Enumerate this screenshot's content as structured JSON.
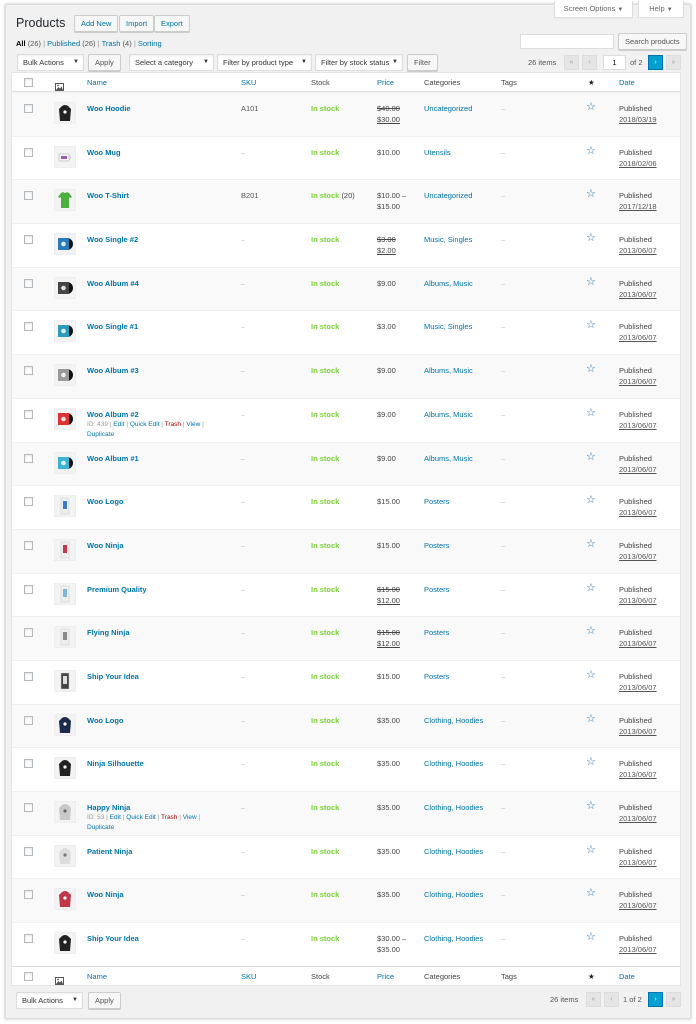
{
  "page": {
    "title": "Products",
    "add_new": "Add New",
    "import": "Import",
    "export": "Export",
    "screen_options": "Screen Options",
    "help": "Help"
  },
  "views": {
    "all": "All",
    "all_count": "(26)",
    "published": "Published",
    "published_count": "(26)",
    "trash": "Trash",
    "trash_count": "(4)",
    "sorting": "Sorting",
    "sep": "|"
  },
  "search": {
    "placeholder": "",
    "button": "Search products"
  },
  "filters": {
    "bulk_actions": "Bulk Actions",
    "apply": "Apply",
    "category": "Select a category",
    "product_type": "Filter by product type",
    "stock_status": "Filter by stock status",
    "filter": "Filter"
  },
  "pagination": {
    "items": "26 items",
    "first": "«",
    "prev": "‹",
    "next": "›",
    "last": "»",
    "current": "1",
    "of_total": "of 2",
    "bottom_label": "1 of 2"
  },
  "columns": {
    "name": "Name",
    "sku": "SKU",
    "stock": "Stock",
    "price": "Price",
    "categories": "Categories",
    "tags": "Tags",
    "featured": "★",
    "date": "Date"
  },
  "icons": {
    "image_col": "image-icon",
    "featured": "star-icon",
    "checkbox": "checkbox-icon",
    "caret": "caret-down-icon"
  },
  "colors": {
    "accent": "#0073aa",
    "in_stock": "#7ad03a",
    "trash": "#a00000",
    "pager_active": "#00a0d2"
  },
  "row_actions_labels": {
    "edit": "Edit",
    "quick_edit": "Quick Edit",
    "trash": "Trash",
    "view": "View",
    "duplicate": "Duplicate",
    "sep": "|"
  },
  "products": [
    {
      "name": "Woo Hoodie",
      "sku": "A101",
      "stock": "In stock",
      "stock_count": "",
      "price_old": "$40.00",
      "price": "$30.00",
      "categories": "Uncategorized",
      "tags": "–",
      "status": "Published",
      "date": "2018/03/19",
      "thumb": "hoodie-black",
      "id_label": ""
    },
    {
      "name": "Woo Mug",
      "sku": "–",
      "stock": "In stock",
      "stock_count": "",
      "price_old": "",
      "price": "$10.00",
      "categories": "Utensils",
      "tags": "–",
      "status": "Published",
      "date": "2018/02/06",
      "thumb": "mug",
      "id_label": ""
    },
    {
      "name": "Woo T-Shirt",
      "sku": "B201",
      "stock": "In stock",
      "stock_count": "(20)",
      "price_old": "",
      "price": "$10.00 –",
      "price2": "$15.00",
      "categories": "Uncategorized",
      "tags": "–",
      "status": "Published",
      "date": "2017/12/18",
      "thumb": "tshirt-green",
      "id_label": ""
    },
    {
      "name": "Woo Single #2",
      "sku": "–",
      "stock": "In stock",
      "stock_count": "",
      "price_old": "$3.00",
      "price": "$2.00",
      "categories": "Music, Singles",
      "tags": "–",
      "status": "Published",
      "date": "2013/06/07",
      "thumb": "album-blue",
      "id_label": ""
    },
    {
      "name": "Woo Album #4",
      "sku": "–",
      "stock": "In stock",
      "stock_count": "",
      "price_old": "",
      "price": "$9.00",
      "categories": "Albums, Music",
      "tags": "–",
      "status": "Published",
      "date": "2013/06/07",
      "thumb": "album-dark",
      "id_label": ""
    },
    {
      "name": "Woo Single #1",
      "sku": "–",
      "stock": "In stock",
      "stock_count": "",
      "price_old": "",
      "price": "$3.00",
      "categories": "Music, Singles",
      "tags": "–",
      "status": "Published",
      "date": "2013/06/07",
      "thumb": "album-teal",
      "id_label": ""
    },
    {
      "name": "Woo Album #3",
      "sku": "–",
      "stock": "In stock",
      "stock_count": "",
      "price_old": "",
      "price": "$9.00",
      "categories": "Albums, Music",
      "tags": "–",
      "status": "Published",
      "date": "2013/06/07",
      "thumb": "album-grey",
      "id_label": ""
    },
    {
      "name": "Woo Album #2",
      "sku": "–",
      "stock": "In stock",
      "stock_count": "",
      "price_old": "",
      "price": "$9.00",
      "categories": "Albums, Music",
      "tags": "–",
      "status": "Published",
      "date": "2013/06/07",
      "thumb": "album-red",
      "id_label": "ID: 439"
    },
    {
      "name": "Woo Album #1",
      "sku": "–",
      "stock": "In stock",
      "stock_count": "",
      "price_old": "",
      "price": "$9.00",
      "categories": "Albums, Music",
      "tags": "–",
      "status": "Published",
      "date": "2013/06/07",
      "thumb": "album-cyan",
      "id_label": ""
    },
    {
      "name": "Woo Logo",
      "sku": "–",
      "stock": "In stock",
      "stock_count": "",
      "price_old": "",
      "price": "$15.00",
      "categories": "Posters",
      "tags": "–",
      "status": "Published",
      "date": "2013/06/07",
      "thumb": "poster-blue",
      "id_label": ""
    },
    {
      "name": "Woo Ninja",
      "sku": "–",
      "stock": "In stock",
      "stock_count": "",
      "price_old": "",
      "price": "$15.00",
      "categories": "Posters",
      "tags": "–",
      "status": "Published",
      "date": "2013/06/07",
      "thumb": "poster-red",
      "id_label": ""
    },
    {
      "name": "Premium Quality",
      "sku": "–",
      "stock": "In stock",
      "stock_count": "",
      "price_old": "$15.00",
      "price": "$12.00",
      "categories": "Posters",
      "tags": "–",
      "status": "Published",
      "date": "2013/06/07",
      "thumb": "poster-lightblue",
      "id_label": ""
    },
    {
      "name": "Flying Ninja",
      "sku": "–",
      "stock": "In stock",
      "stock_count": "",
      "price_old": "$15.00",
      "price": "$12.00",
      "categories": "Posters",
      "tags": "–",
      "status": "Published",
      "date": "2013/06/07",
      "thumb": "poster-grey",
      "id_label": ""
    },
    {
      "name": "Ship Your Idea",
      "sku": "–",
      "stock": "In stock",
      "stock_count": "",
      "price_old": "",
      "price": "$15.00",
      "categories": "Posters",
      "tags": "–",
      "status": "Published",
      "date": "2013/06/07",
      "thumb": "poster-white",
      "id_label": ""
    },
    {
      "name": "Woo Logo",
      "sku": "–",
      "stock": "In stock",
      "stock_count": "",
      "price_old": "",
      "price": "$35.00",
      "categories": "Clothing, Hoodies",
      "tags": "–",
      "status": "Published",
      "date": "2013/06/07",
      "thumb": "hoodie-navy",
      "id_label": ""
    },
    {
      "name": "Ninja Silhouette",
      "sku": "–",
      "stock": "In stock",
      "stock_count": "",
      "price_old": "",
      "price": "$35.00",
      "categories": "Clothing, Hoodies",
      "tags": "–",
      "status": "Published",
      "date": "2013/06/07",
      "thumb": "hoodie-black",
      "id_label": ""
    },
    {
      "name": "Happy Ninja",
      "sku": "–",
      "stock": "In stock",
      "stock_count": "",
      "price_old": "",
      "price": "$35.00",
      "categories": "Clothing, Hoodies",
      "tags": "–",
      "status": "Published",
      "date": "2013/06/07",
      "thumb": "hoodie-grey",
      "id_label": "ID: 53"
    },
    {
      "name": "Patient Ninja",
      "sku": "–",
      "stock": "In stock",
      "stock_count": "",
      "price_old": "",
      "price": "$35.00",
      "categories": "Clothing, Hoodies",
      "tags": "–",
      "status": "Published",
      "date": "2013/06/07",
      "thumb": "hoodie-lightgrey",
      "id_label": ""
    },
    {
      "name": "Woo Ninja",
      "sku": "–",
      "stock": "In stock",
      "stock_count": "",
      "price_old": "",
      "price": "$35.00",
      "categories": "Clothing, Hoodies",
      "tags": "–",
      "status": "Published",
      "date": "2013/06/07",
      "thumb": "hoodie-red",
      "id_label": ""
    },
    {
      "name": "Ship Your Idea",
      "sku": "–",
      "stock": "In stock",
      "stock_count": "",
      "price_old": "",
      "price": "$30.00 –",
      "price2": "$35.00",
      "categories": "Clothing, Hoodies",
      "tags": "–",
      "status": "Published",
      "date": "2013/06/07",
      "thumb": "hoodie-black",
      "id_label": ""
    }
  ]
}
